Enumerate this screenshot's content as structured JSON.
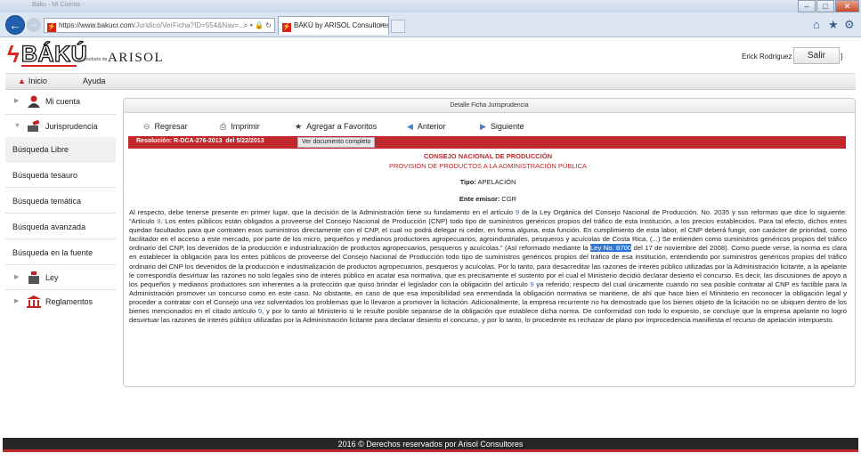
{
  "browser": {
    "title_text": "Baku - Mi Cuenta - ",
    "url_prefix": "https://www.bakucr.com",
    "url_tail": "/Juridico/VerFicha?ID=554&Nav=...",
    "tab_label": "BÁKÚ by ARISOL Consultores"
  },
  "header": {
    "logo_text": "BÁKÚ",
    "logo_sub": "un producto de",
    "logo_brand": "ARISOL",
    "user_name": "Erick Rodriguez ! [",
    "logout_label": "Salir",
    "logout_bracket": "]"
  },
  "menu": {
    "home_label": "Inicio",
    "help_label": "Ayuda"
  },
  "sidebar": {
    "mi_cuenta": "Mi cuenta",
    "jurisprudencia": "Jurisprudencia",
    "links": [
      "Búsqueda Libre",
      "Búsqueda tesauro",
      "Búsqueda temática",
      "Búsqueda avanzada",
      "Búsqueda en la fuente"
    ],
    "ley": "Ley",
    "reglamentos": "Reglamentos"
  },
  "panel": {
    "title": "Detalle Ficha Jurisprudencia",
    "toolbar": {
      "back": "Regresar",
      "print": "Imprimir",
      "favorites": "Agregar a Favoritos",
      "previous": "Anterior",
      "next": "Siguiente"
    },
    "resolution_label": "Resolución:",
    "resolution_number": "R-DCA-276-2013",
    "resolution_del": "del",
    "resolution_date": "5/22/2013",
    "view_full_doc": "Ver documento completo"
  },
  "document": {
    "organization": "CONSEJO NACIONAL DE PRODUCCIÓN",
    "subject": "PROVISIÓN DE PRODUCTOS A LA ADMINISTRACIÓN PÚBLICA",
    "type_label": "Tipo:",
    "type_value": "APELACIÓN",
    "issuer_label": "Ente emisor:",
    "issuer_value": "CGR",
    "p1": "Al respecto, debe tenerse presente en primer lugar, que la decisión de la Administración tiene su fundamento en el artículo ",
    "link1": "9",
    "p2": " de la Ley Orgánica del Consejo Nacional de Producción. No. 2035 y sus reformas que dice lo siguiente: “Artículo ",
    "link2": "9",
    "p3": ". Los entes públicos están obligados a proveerse del Consejo Nacional de Producción (CNP) todo tipo de suministros genéricos propios del tráfico de esta Institución, a los precios establecidos. Para tal efecto, dichos entes quedan facultados para que contraten esos suministros directamente con el CNP, el cual no podrá delegar ni ceder, en forma alguna, esta función. En cumplimiento de esta labor, el CNP deberá fungir, con carácter de prioridad, como facilitador en el acceso a este mercado, por parte de los micro, pequeños y medianos productores agropecuarios, agroindustriales, pesqueros y acuícolas de Costa Rica. (...) Se entienden como suministros genéricos propios del tráfico ordinario del CNP, los devenidos de la producción e industrialización de productos agropecuarios, pesqueros y acuícolas.” (Así reformado mediante la ",
    "link3": "Ley No. 8700",
    "p4": " del 17 de noviembre del 2008). Como puede verse, la norma es clara en establecer la obligación para los entes públicos de proveerse del Consejo Nacional de Producción todo tipo de suministros genéricos propios del tráfico de esa institución, entendiendo por suministros genéricos propios del tráfico ordinario del CNP los devenidos de la producción e industrialización de productos agropecuarios, pesqueros y acuícolas. Por lo tanto, para desacreditar las razones de interés público utilizadas por la Administración licitante, a la apelante le correspondía desvirtuar las razones no solo legales sino de interés público en acatar esa normativa, que es precisamente el sustento por el cual el Ministerio decidió declarar desierto el concurso. Es decir, las discusiones de apoyo a los pequeños y medianos productores son inherentes a la protección que quiso brindar el legislador con la obligación del artículo ",
    "link4": "9",
    "p5": " ya referido; respecto del cual únicamente cuando no sea posible contratar al CNP es factible para la Administración promover un concurso como en este caso. No obstante, en caso de que esa imposibilidad sea enmendada la obligación normativa se mantiene, de ahí que hace bien el Ministerio en reconocer la obligación legal y proceder a contratar con el Consejo una vez solventados los problemas que lo llevaron a promover la licitación. Adicionalmente, la empresa recurrente no ha demostrado que los bienes objeto de la licitación no se ubiquen dentro de los bienes mencionados en el citado artículo ",
    "link5": "9",
    "p6": ", y por lo tanto al Ministerio si le resulte posible separarse de la obligación que establece dicha norma. De conformidad con todo lo expuesto, se concluye que la empresa apelante no logró desvirtuar las razones de interés público utilizadas por la Administración licitante para declarar desierto el concurso, y por lo tanto, lo procedente es rechazar de plano por improcedencia manifiesta el recurso de apelación interpuesto."
  },
  "footer": {
    "text": "2016 © Derechos reservados por Arisol Consultores"
  },
  "colors": {
    "brand_red": "#c0282b",
    "link_blue": "#3a6fb5",
    "footer_bg": "#262626"
  }
}
